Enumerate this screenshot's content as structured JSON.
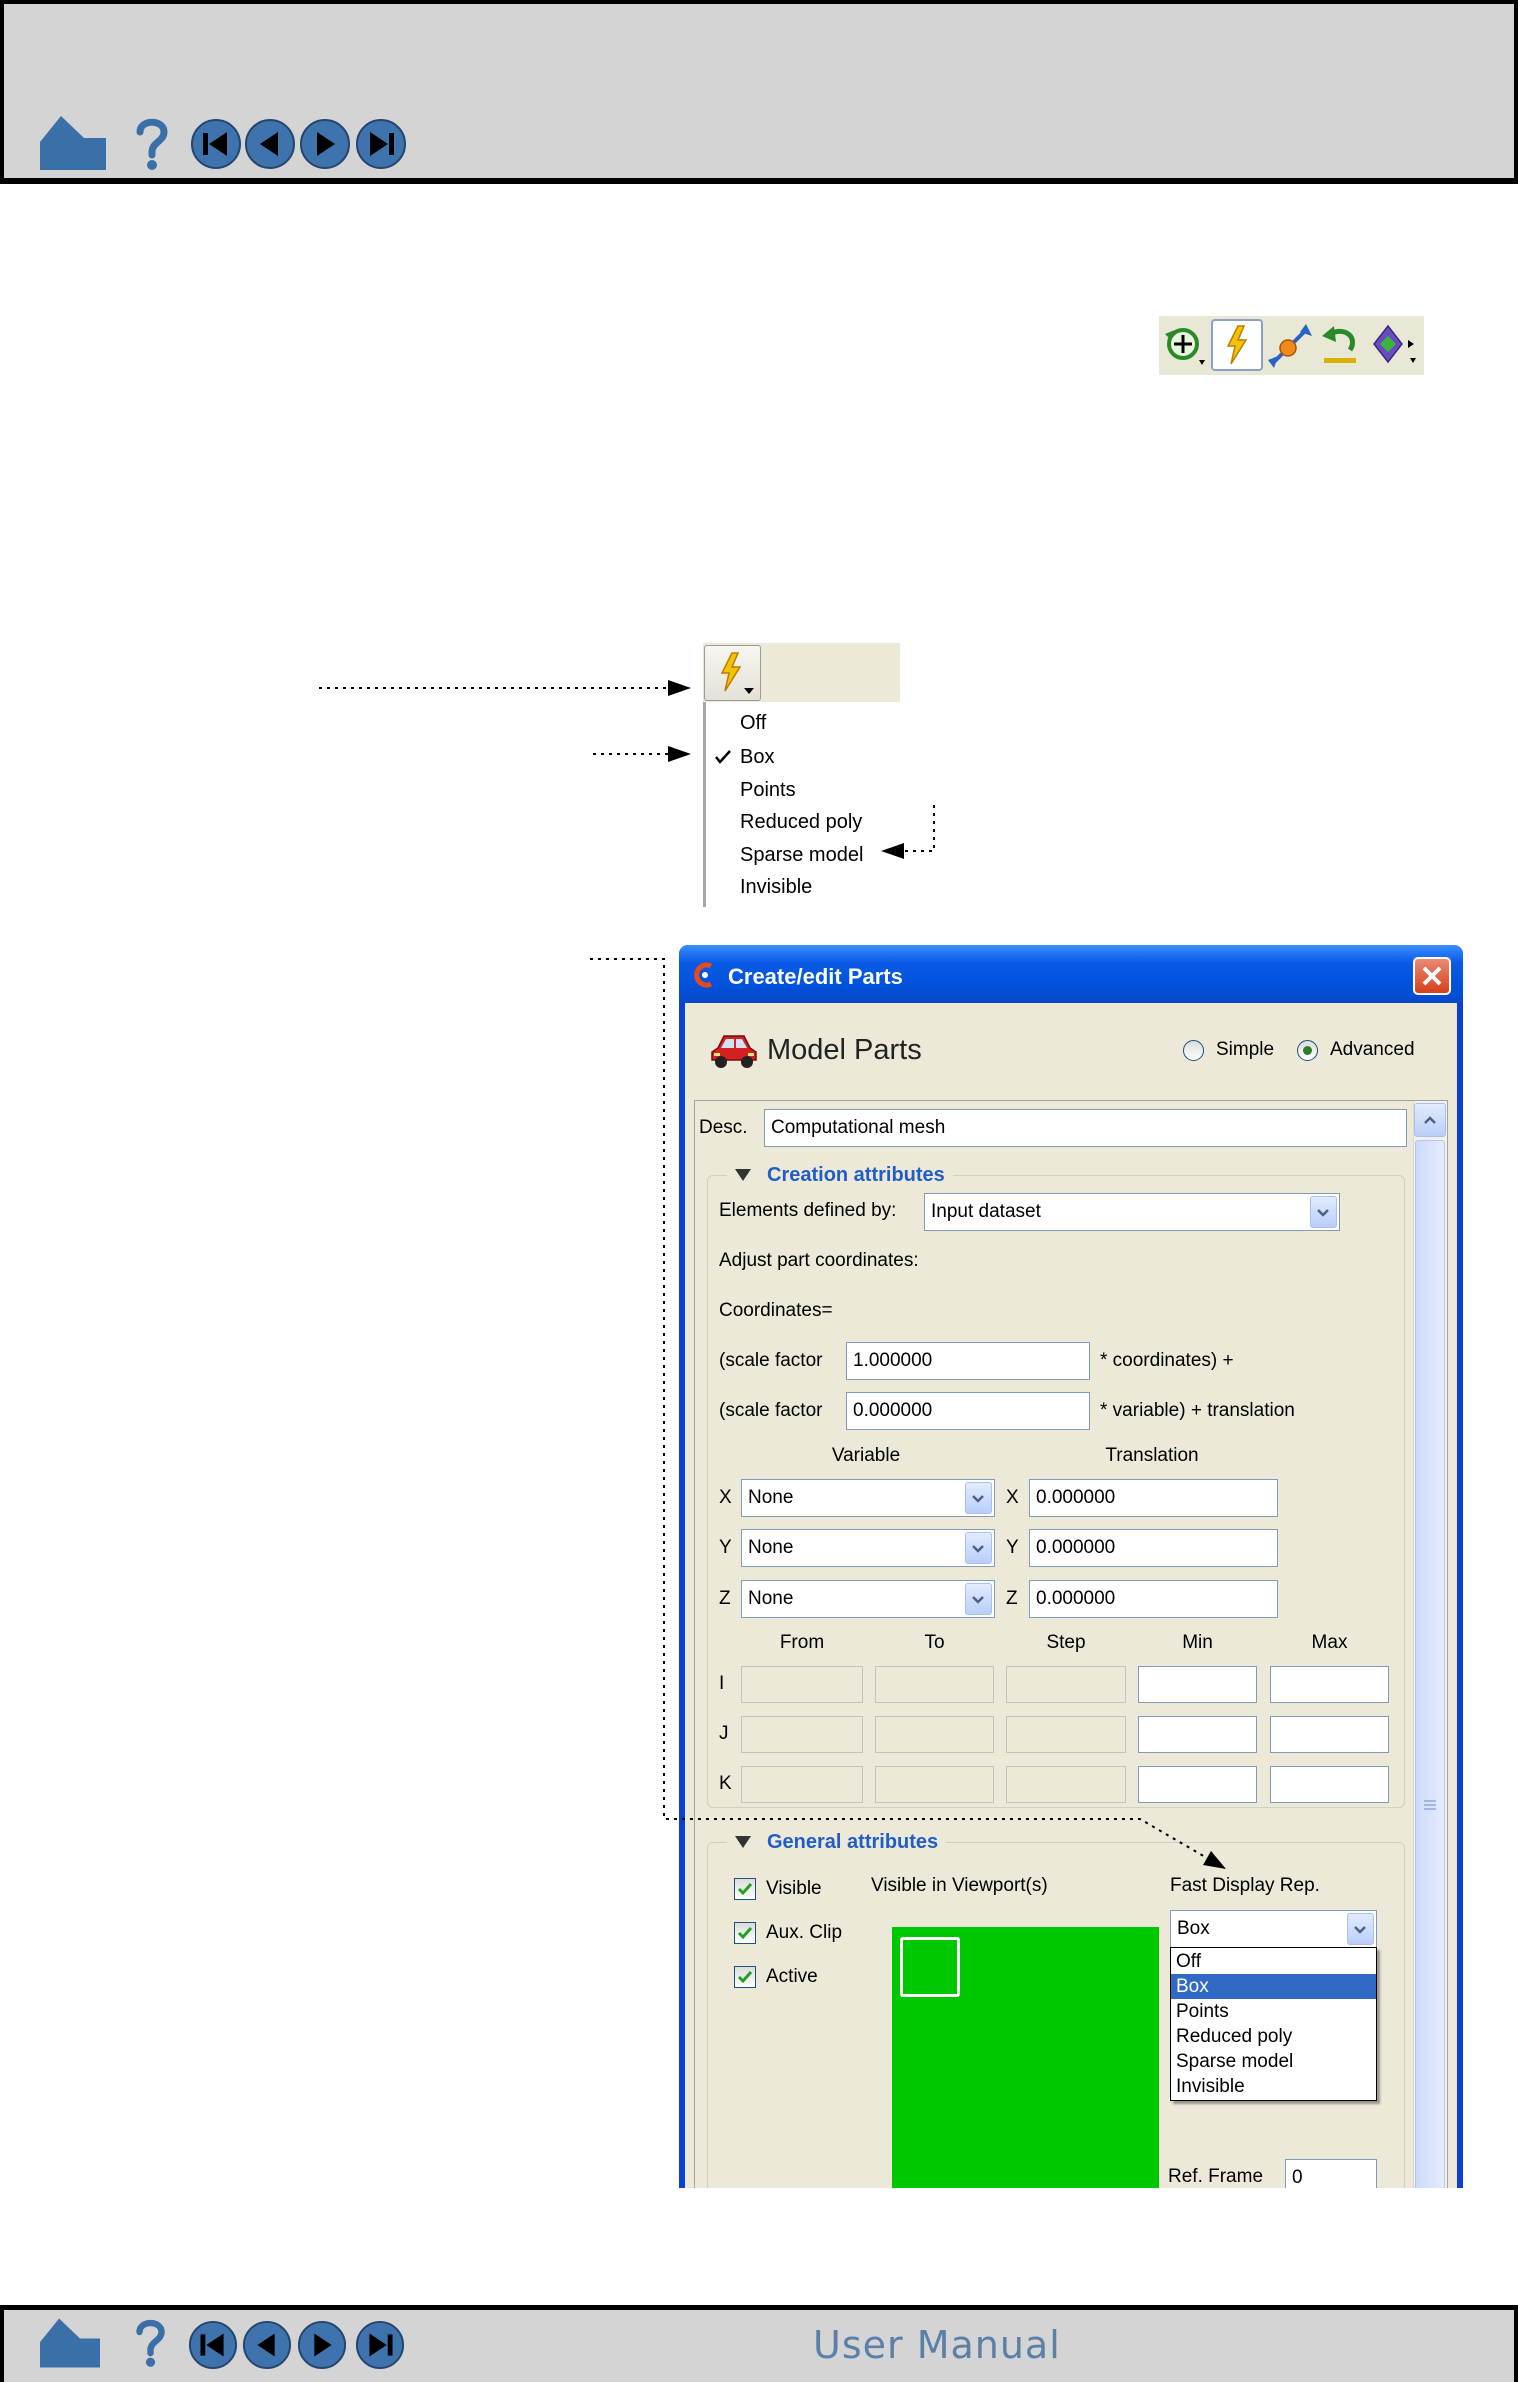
{
  "header": {
    "nav_icons": [
      "home-icon",
      "help-icon",
      "first-page-icon",
      "prev-page-icon",
      "next-page-icon",
      "last-page-icon"
    ]
  },
  "toolbar": {
    "icons": [
      "zoom-icon",
      "fast-display-icon",
      "transform-icon",
      "undo-icon",
      "view-icon"
    ]
  },
  "fast_display_menu": {
    "button_icon": "fast-display-icon",
    "items": [
      {
        "label": "Off",
        "checked": false
      },
      {
        "label": "Box",
        "checked": true
      },
      {
        "label": "Points",
        "checked": false
      },
      {
        "label": "Reduced poly",
        "checked": false
      },
      {
        "label": "Sparse model",
        "checked": false
      },
      {
        "label": "Invisible",
        "checked": false
      }
    ]
  },
  "dialog": {
    "title": "Create/edit Parts",
    "heading": "Model Parts",
    "mode_options": [
      {
        "label": "Simple",
        "selected": false
      },
      {
        "label": "Advanced",
        "selected": true
      }
    ],
    "desc_label": "Desc.",
    "desc_value": "Computational mesh",
    "creation": {
      "title": "Creation attributes",
      "elements_label": "Elements defined by:",
      "elements_value": "Input dataset",
      "adjust_label": "Adjust part coordinates:",
      "coordinates_label": "Coordinates=",
      "scale_rows": [
        {
          "label": "(scale factor",
          "value": "1.000000",
          "suffix": "* coordinates) +"
        },
        {
          "label": "(scale factor",
          "value": "0.000000",
          "suffix": "* variable) + translation"
        }
      ],
      "variable_header": "Variable",
      "translation_header": "Translation",
      "axes": [
        {
          "axis": "X",
          "variable": "None",
          "translation": "0.000000"
        },
        {
          "axis": "Y",
          "variable": "None",
          "translation": "0.000000"
        },
        {
          "axis": "Z",
          "variable": "None",
          "translation": "0.000000"
        }
      ],
      "range_headers": [
        "From",
        "To",
        "Step",
        "Min",
        "Max"
      ],
      "range_rows": [
        "I",
        "J",
        "K"
      ]
    },
    "general": {
      "title": "General attributes",
      "checkboxes": [
        {
          "label": "Visible",
          "checked": true
        },
        {
          "label": "Aux. Clip",
          "checked": true
        },
        {
          "label": "Active",
          "checked": true
        }
      ],
      "viewport_label": "Visible in Viewport(s)",
      "fast_display_label": "Fast Display Rep.",
      "fast_display_value": "Box",
      "fast_display_options": [
        {
          "label": "Off",
          "highlighted": false
        },
        {
          "label": "Box",
          "highlighted": true
        },
        {
          "label": "Points",
          "highlighted": false
        },
        {
          "label": "Reduced poly",
          "highlighted": false
        },
        {
          "label": "Sparse model",
          "highlighted": false
        },
        {
          "label": "Invisible",
          "highlighted": false
        }
      ],
      "ref_frame_label": "Ref. Frame",
      "ref_frame_value": "0"
    }
  },
  "footer": {
    "title": "User Manual"
  },
  "colors": {
    "viewport": "#00c800",
    "selection": "#316ac5",
    "titlebar": "#0a5ae6",
    "group_title": "#215dc6",
    "footer_title": "#5b80a8"
  }
}
